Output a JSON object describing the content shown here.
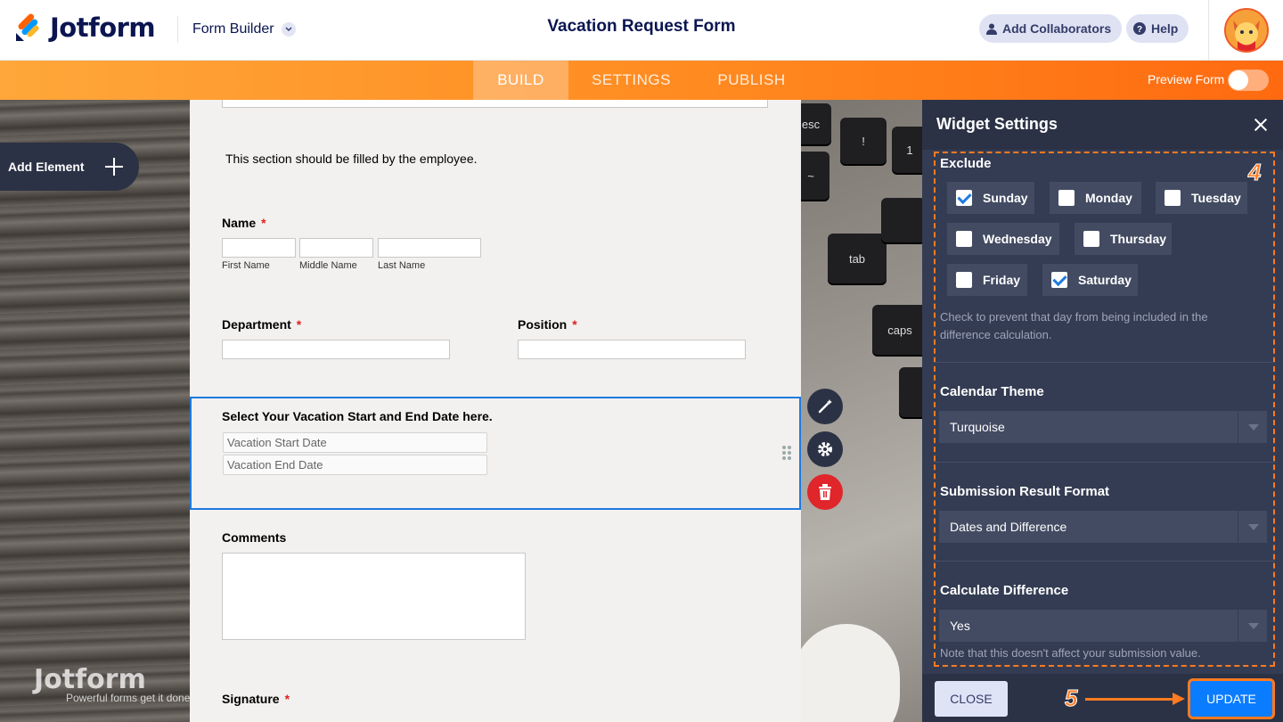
{
  "header": {
    "brand": "Jotform",
    "builder_label": "Form Builder",
    "form_title": "Vacation Request Form",
    "add_collaborators": "Add Collaborators",
    "help": "Help",
    "brand_colors": {
      "navy": "#0a1551",
      "orange": "#ff6100"
    }
  },
  "nav": {
    "tabs": [
      "BUILD",
      "SETTINGS",
      "PUBLISH"
    ],
    "active": "BUILD",
    "preview_label": "Preview Form",
    "preview_on": false
  },
  "sidebar": {
    "add_element": "Add Element"
  },
  "watermark": {
    "brand": "Jotform",
    "tagline": "Powerful forms get it done"
  },
  "keyboard_keys": [
    "esc",
    "!",
    "1",
    "~",
    "tab",
    "caps"
  ],
  "form": {
    "intro": "This section should be filled by the employee.",
    "name": {
      "label": "Name",
      "required_mark": "*",
      "sublabels": [
        "First Name",
        "Middle Name",
        "Last Name"
      ]
    },
    "department": {
      "label": "Department",
      "required_mark": "*"
    },
    "position": {
      "label": "Position",
      "required_mark": "*"
    },
    "dates": {
      "label": "Select Your Vacation Start and End Date here.",
      "start_placeholder": "Vacation Start Date",
      "end_placeholder": "Vacation End Date"
    },
    "comments": {
      "label": "Comments"
    },
    "signature": {
      "label": "Signature",
      "required_mark": "*"
    }
  },
  "panel": {
    "title": "Widget Settings",
    "step_top": "4",
    "step_bottom": "5",
    "exclude": {
      "label": "Exclude",
      "days": [
        {
          "name": "Sunday",
          "checked": true
        },
        {
          "name": "Monday",
          "checked": false
        },
        {
          "name": "Tuesday",
          "checked": false
        },
        {
          "name": "Wednesday",
          "checked": false
        },
        {
          "name": "Thursday",
          "checked": false
        },
        {
          "name": "Friday",
          "checked": false
        },
        {
          "name": "Saturday",
          "checked": true
        }
      ],
      "help": "Check to prevent that day from being included in the difference calculation."
    },
    "calendar_theme": {
      "label": "Calendar Theme",
      "value": "Turquoise"
    },
    "submission_format": {
      "label": "Submission Result Format",
      "value": "Dates and Difference"
    },
    "calculate_difference": {
      "label": "Calculate Difference",
      "value": "Yes",
      "note": "Note that this doesn't affect your submission value."
    },
    "close_button": "CLOSE",
    "update_button": "UPDATE"
  }
}
